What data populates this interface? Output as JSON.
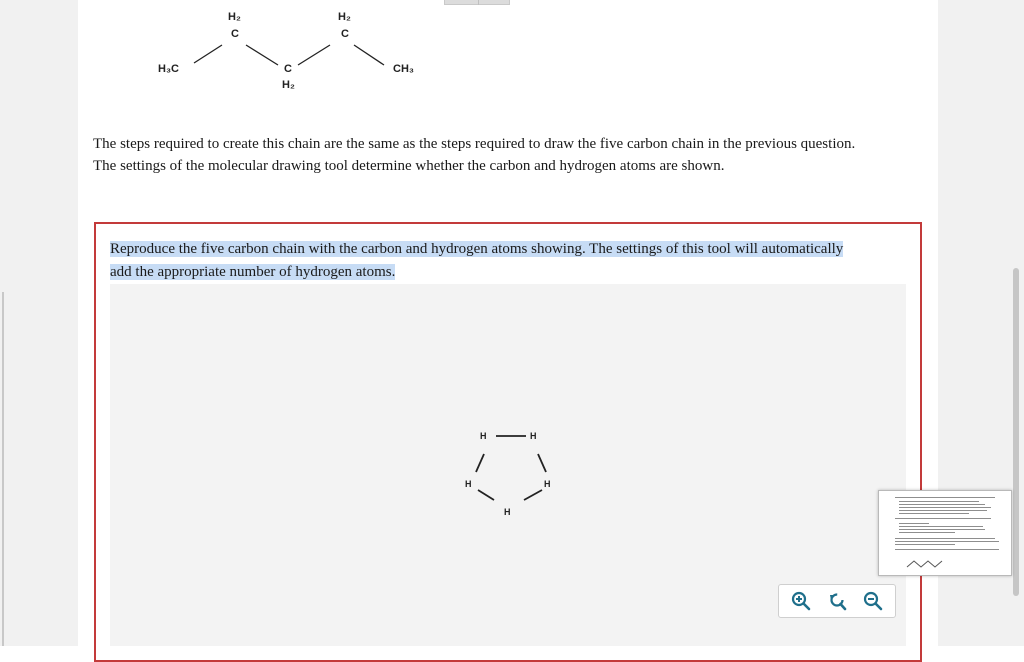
{
  "reference_molecule": {
    "atoms": {
      "h3c": "H₃C",
      "c1": "C",
      "h2_c1": "H₂",
      "c2": "C",
      "h2_c2": "H₂",
      "c3": "C",
      "h2_c3": "H₂",
      "ch3": "CH₃"
    }
  },
  "description": {
    "line1": "The steps required to create this chain are the same as the steps required to draw the five carbon chain in the previous question.",
    "line2": "The settings of the molecular drawing tool determine whether the carbon and hydrogen atoms are shown."
  },
  "question": {
    "prompt_line1": "Reproduce the five carbon chain with the carbon and hydrogen atoms showing. The settings of this tool will automatically",
    "prompt_line2": "add the appropriate number of hydrogen atoms."
  },
  "drawing_canvas": {
    "atom_labels": [
      "H",
      "H",
      "H",
      "H",
      "H"
    ]
  },
  "toolbar": {
    "icons": [
      "zoom-in-icon",
      "reset-view-icon",
      "zoom-out-icon"
    ],
    "accent_color": "#1f6f8b"
  },
  "colors": {
    "question_border": "#c33a3a",
    "highlight": "#c7dcf5",
    "canvas_background": "#f3f3f3"
  }
}
